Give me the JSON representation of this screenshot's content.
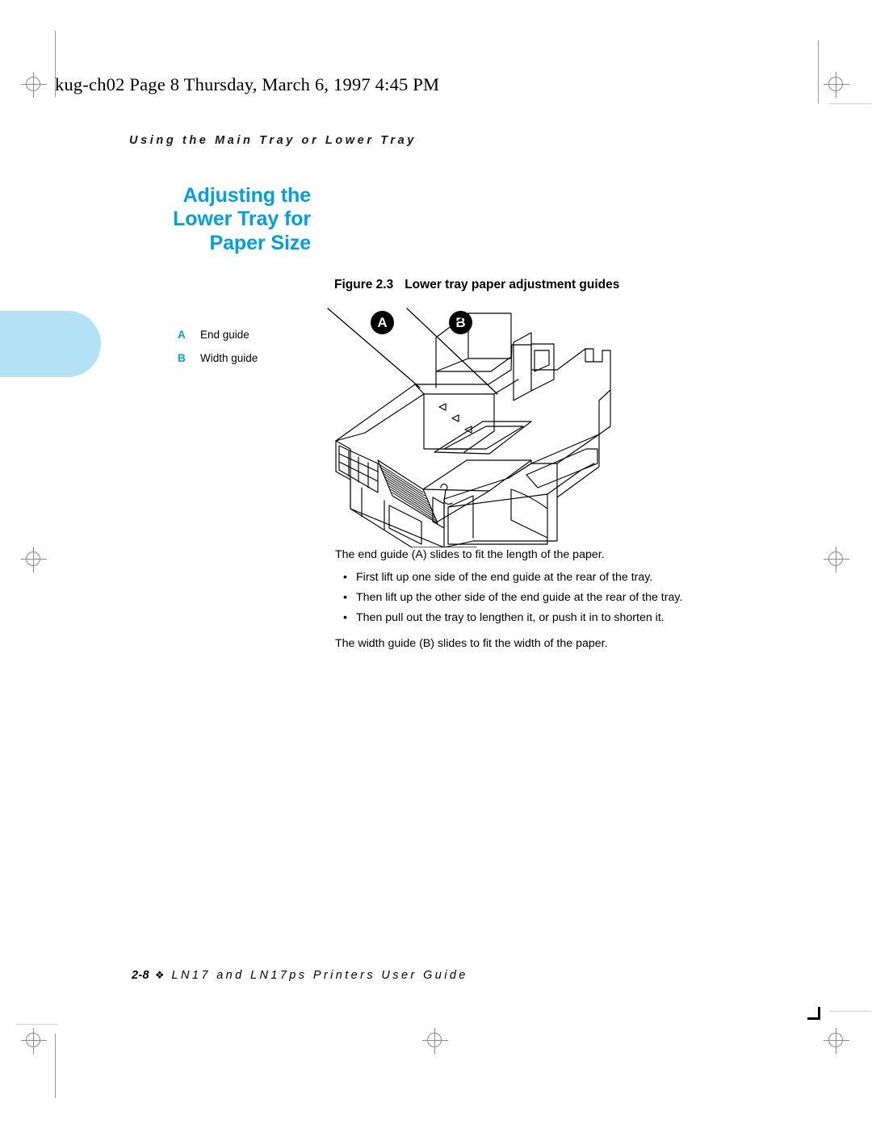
{
  "slug": {
    "text": "kug-ch02  Page 8  Thursday, March 6, 1997  4:45 PM"
  },
  "running_head": {
    "text": "Using the Main Tray or Lower Tray"
  },
  "heading": {
    "line1": "Adjusting the",
    "line2": "Lower Tray for",
    "line3": "Paper Size",
    "color": "#00a0e3"
  },
  "figure": {
    "number": "Figure 2.3",
    "title": "Lower tray paper adjustment guides",
    "legend": [
      {
        "key": "A",
        "label": "End guide"
      },
      {
        "key": "B",
        "label": "Width guide"
      }
    ],
    "callouts": [
      {
        "label": "A"
      },
      {
        "label": "B"
      }
    ],
    "artwork_name": "lower-paper-tray-line-drawing"
  },
  "body": {
    "intro_end_guide": "The end guide (A) slides to fit the length of the paper.",
    "bullet_marker": "•",
    "steps": [
      "First lift up one side of the end guide at the rear of the tray.",
      "Then lift up the other side of the end guide at the rear of the tray.",
      "Then pull out the tray to lengthen it, or push it in to shorten it."
    ],
    "intro_width_guide": "The width guide (B) slides to fit the width of the paper."
  },
  "footer": {
    "folio": "2-8",
    "ornament": "❖",
    "book_title": "LN17 and LN17ps Printers User Guide"
  },
  "tab": {
    "color": "#b3e2f7"
  }
}
